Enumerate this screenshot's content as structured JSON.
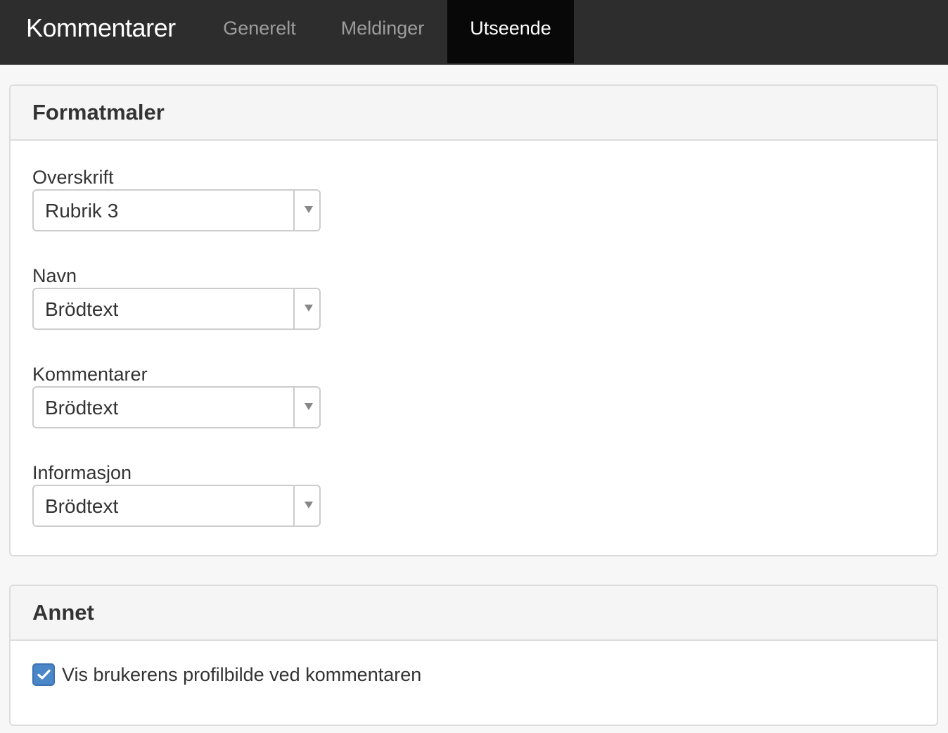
{
  "header": {
    "brand": "Kommentarer",
    "tabs": [
      {
        "label": "Generelt",
        "active": false
      },
      {
        "label": "Meldinger",
        "active": false
      },
      {
        "label": "Utseende",
        "active": true
      }
    ]
  },
  "formatmaler": {
    "title": "Formatmaler",
    "fields": [
      {
        "label": "Overskrift",
        "value": "Rubrik 3"
      },
      {
        "label": "Navn",
        "value": "Brödtext"
      },
      {
        "label": "Kommentarer",
        "value": "Brödtext"
      },
      {
        "label": "Informasjon",
        "value": "Brödtext"
      }
    ]
  },
  "annet": {
    "title": "Annet",
    "checkbox": {
      "label": "Vis brukerens profilbilde ved kommentaren",
      "checked": true
    }
  },
  "icons": {
    "dropdown": "caret-down-icon",
    "checkbox": "check-icon"
  },
  "colors": {
    "navbar": "#2d2d2d",
    "active_tab": "#080808",
    "checkbox": "#4a86c8"
  }
}
